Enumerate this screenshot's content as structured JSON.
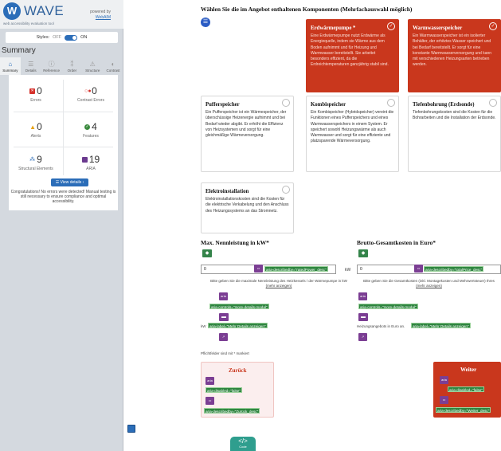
{
  "wave": {
    "logo_letter": "W",
    "title": "WAVE",
    "subtitle": "web accessibility evaluation tool",
    "powered_by": "powered by",
    "webaim": "WebAIM",
    "styles_label": "Styles:",
    "off": "OFF",
    "on": "ON",
    "summary_heading": "Summary",
    "tabs": [
      {
        "label": "Summary",
        "icon": "home-icon"
      },
      {
        "label": "Details",
        "icon": "list-icon"
      },
      {
        "label": "Reference",
        "icon": "info-icon"
      },
      {
        "label": "Order",
        "icon": "order-icon"
      },
      {
        "label": "Structure",
        "icon": "structure-icon"
      },
      {
        "label": "Contrast",
        "icon": "contrast-icon"
      }
    ],
    "stats": {
      "errors": {
        "count": "0",
        "label": "Errors"
      },
      "contrast_errors": {
        "count": "0",
        "label": "Contrast Errors"
      },
      "alerts": {
        "count": "0",
        "label": "Alerts"
      },
      "features": {
        "count": "4",
        "label": "Features"
      },
      "structural": {
        "count": "9",
        "label": "Structural Elements"
      },
      "aria": {
        "count": "19",
        "label": "ARIA"
      }
    },
    "view_details": "View details ›",
    "congrats": "Congratulations! No errors were detected! Manual testing is still necessary to ensure compliance and optimal accessibility."
  },
  "main": {
    "question": "Wählen Sie die im Angebot enthaltenen Komponenten (Mehrfachauswahl möglich)",
    "cards": [
      {
        "title": "Erdwärmepumpe *",
        "text": "Eine Erdwärmepumpe nutzt Erdwärme als Energiequelle, indem sie Wärme aus dem Boden aufnimmt und für Heizung und Warmwasser bereitstellt. Sie arbeitet besonders effizient, da die Erdreichtemperaturen ganzjährig stabil sind.",
        "selected": true
      },
      {
        "title": "Warmwasserspeicher",
        "text": "Ein Warmwasserspeicher ist ein isolierter Behälter, der erhitztes Wasser speichert und bei Bedarf bereitstellt. Er sorgt für eine konstante Warmwasserversorgung und kann mit verschiedenen Heizungsarten betrieben werden.",
        "selected": true
      },
      {
        "title": "Pufferspeicher",
        "text": "Ein Pufferspeicher ist ein Wärmespeicher, der überschüssige Heizenergie aufnimmt und bei Bedarf wieder abgibt. Er erhöht die Effizienz von Heizsystemen und sorgt für eine gleichmäßige Wärmeversorgung.",
        "selected": false
      },
      {
        "title": "Kombispeicher",
        "text": "Ein Kombispeicher (Hybridspeicher) vereint die Funktionen eines Pufferspeichers und eines Warmwasserspeichers in einem System. Er speichert sowohl Heizungswärme als auch Warmwasser und sorgt für eine effiziente und platzsparende Wärmeversorgung.",
        "selected": false
      },
      {
        "title": "Tiefenbohrung (Erdsonde)",
        "text": "Tiefenbohrungskosten sind die Kosten für die Bohrarbeiten und die Installation der Erdsonde.",
        "selected": false
      },
      {
        "title": "Elektroinstallation",
        "text": "Elektroinstallationskosten sind die Kosten für die elektrische Verkabelung und den Anschluss des Heizungssystems an das Stromnetz.",
        "selected": false
      }
    ],
    "power": {
      "heading": "Max. Nennleistung in kW*",
      "value": "0",
      "unit": "kW",
      "describedby": "aria-describedby=\"ratedPower_desc\"",
      "help": "Bitte geben Sie die maximale Nennleistung des Heizkessels / der Wärmepumpe in kW",
      "more": "(mehr anzeigen)",
      "controls": "aria-controls=\"more-details-modal\"",
      "prefix": "kW",
      "label": "aria-label=\"Mehr Details anzeigen\""
    },
    "cost": {
      "heading": "Brutto-Gesamtkosten in Euro*",
      "value": "0",
      "unit": "€",
      "describedby": "aria-describedby=\"totalPrice_desc\"",
      "help": "Bitte geben Sie die Gesamtkosten (inkl. Montagekosten und Mehrwertsteuer) Ihres",
      "more": "(mehr anzeigen)",
      "controls": "aria-controls=\"more-details-modal\"",
      "prefix": "Heizungsangebots in Euro an.",
      "label": "aria-label=\"Mehr Details anzeigen\""
    },
    "required_note": "Pflichtfelder sind mit * markiert",
    "back": {
      "label": "Zurück",
      "disabled": "aria-disabled=\"false\"",
      "describedby": "aria-describedby=\"Zurück_desc\""
    },
    "next": {
      "label": "Weiter",
      "disabled": "aria-disabled=\"false\"",
      "describedby": "aria-describedby=\"Weiter_desc\""
    },
    "aria_tag": "aria",
    "code_button": "</>",
    "code_label": "Code"
  }
}
